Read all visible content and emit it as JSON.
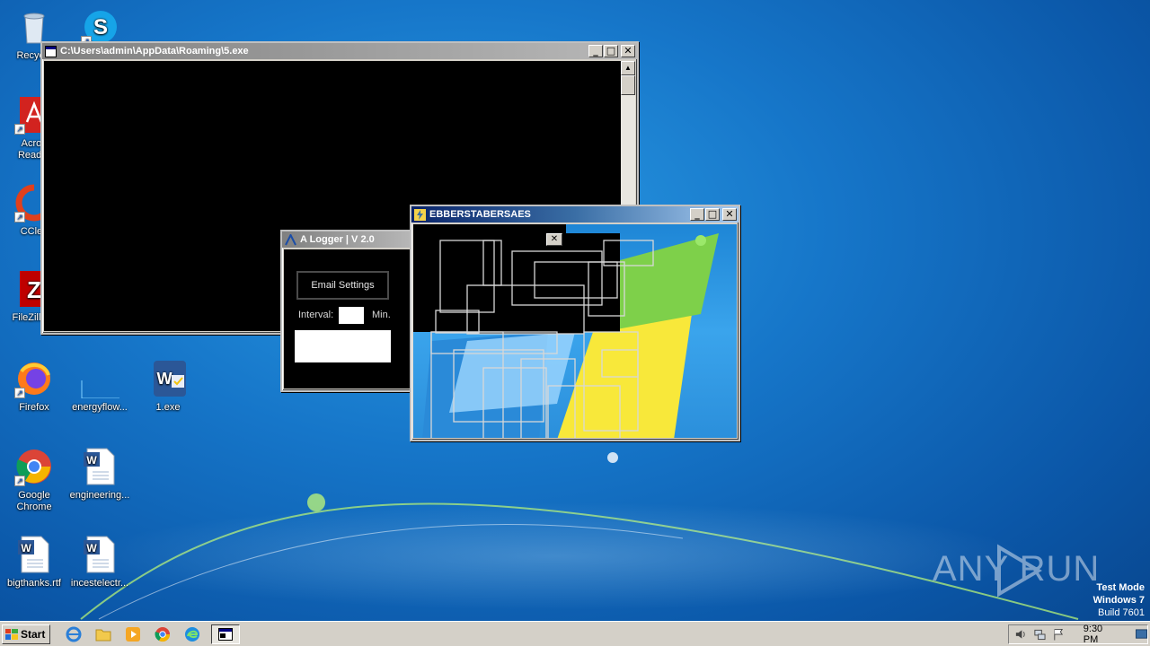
{
  "desktop": {
    "icons": [
      {
        "id": "recycle",
        "label": "Recycle"
      },
      {
        "id": "skype",
        "label": ""
      },
      {
        "id": "acrobat",
        "label": "Acrob\nReader"
      },
      {
        "id": "ccleaner",
        "label": "CClea"
      },
      {
        "id": "filezilla",
        "label": "FileZilla C"
      },
      {
        "id": "firefox",
        "label": "Firefox"
      },
      {
        "id": "energyflow",
        "label": "energyflow..."
      },
      {
        "id": "exe1",
        "label": "1.exe"
      },
      {
        "id": "chrome",
        "label": "Google\nChrome"
      },
      {
        "id": "engineering",
        "label": "engineering..."
      },
      {
        "id": "bigthanks",
        "label": "bigthanks.rtf"
      },
      {
        "id": "incestelect",
        "label": "incestelectr..."
      }
    ]
  },
  "console_window": {
    "title": "C:\\Users\\admin\\AppData\\Roaming\\5.exe"
  },
  "logger_window": {
    "title": "A Logger  |  V 2.0",
    "email_button": "Email Settings",
    "interval_label": "Interval:",
    "interval_value": "",
    "min_label": "Min."
  },
  "ebber_window": {
    "title": "EBBERSTABERSAES"
  },
  "controls": {
    "minimize": "_",
    "maximize": "□",
    "close": "✕"
  },
  "watermark": {
    "brand": "ANY RUN",
    "mode": "Test Mode",
    "os": "Windows 7",
    "build": "Build 7601"
  },
  "taskbar": {
    "start_label": "Start",
    "clock": "9:30 PM",
    "pinned": [
      "internet-explorer-icon",
      "explorer-folder-icon",
      "media-player-icon",
      "chrome-icon",
      "edge-icon",
      "console-task-icon"
    ]
  },
  "colors": {
    "desktop_blue": "#1676c9",
    "title_inactive": "#808080",
    "window_face": "#d4d0c8"
  }
}
